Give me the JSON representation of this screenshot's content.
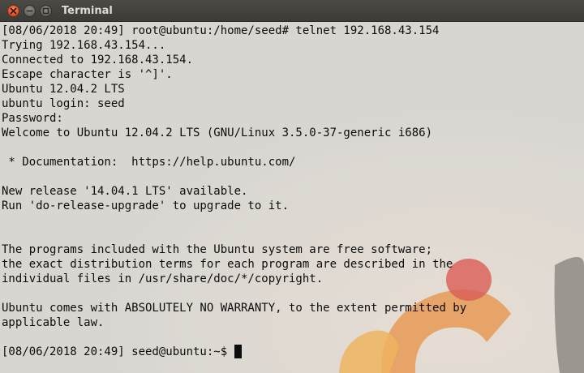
{
  "window": {
    "title": "Terminal"
  },
  "terminal": {
    "lines": [
      "[08/06/2018 20:49] root@ubuntu:/home/seed# telnet 192.168.43.154",
      "Trying 192.168.43.154...",
      "Connected to 192.168.43.154.",
      "Escape character is '^]'.",
      "Ubuntu 12.04.2 LTS",
      "ubuntu login: seed",
      "Password:",
      "Welcome to Ubuntu 12.04.2 LTS (GNU/Linux 3.5.0-37-generic i686)",
      "",
      " * Documentation:  https://help.ubuntu.com/",
      "",
      "New release '14.04.1 LTS' available.",
      "Run 'do-release-upgrade' to upgrade to it.",
      "",
      "",
      "The programs included with the Ubuntu system are free software;",
      "the exact distribution terms for each program are described in the",
      "individual files in /usr/share/doc/*/copyright.",
      "",
      "Ubuntu comes with ABSOLUTELY NO WARRANTY, to the extent permitted by",
      "applicable law.",
      ""
    ],
    "prompt": "[08/06/2018 20:49] seed@ubuntu:~$ "
  },
  "colors": {
    "titlebar": "#3c3b37",
    "close_button": "#e0572f",
    "terminal_text": "#0c0c0c",
    "terminal_background": "#d9d6d2"
  },
  "icons": {
    "close": "close-icon",
    "minimize": "minimize-icon",
    "maximize": "maximize-icon"
  }
}
